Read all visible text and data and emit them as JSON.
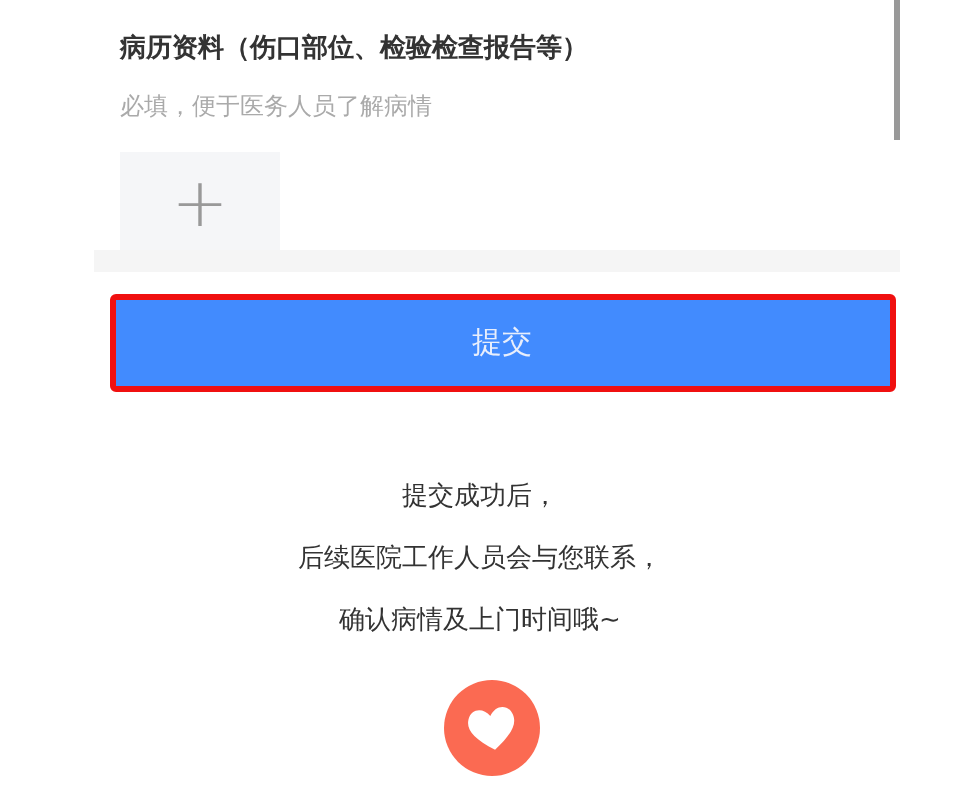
{
  "form": {
    "title": "病历资料（伤口部位、检验检查报告等）",
    "hint": "必填，便于医务人员了解病情",
    "upload_button": "+"
  },
  "submit_button": "提交",
  "notice": [
    "提交成功后，",
    "后续医院工作人员会与您联系，",
    "确认病情及上门时间哦~"
  ]
}
